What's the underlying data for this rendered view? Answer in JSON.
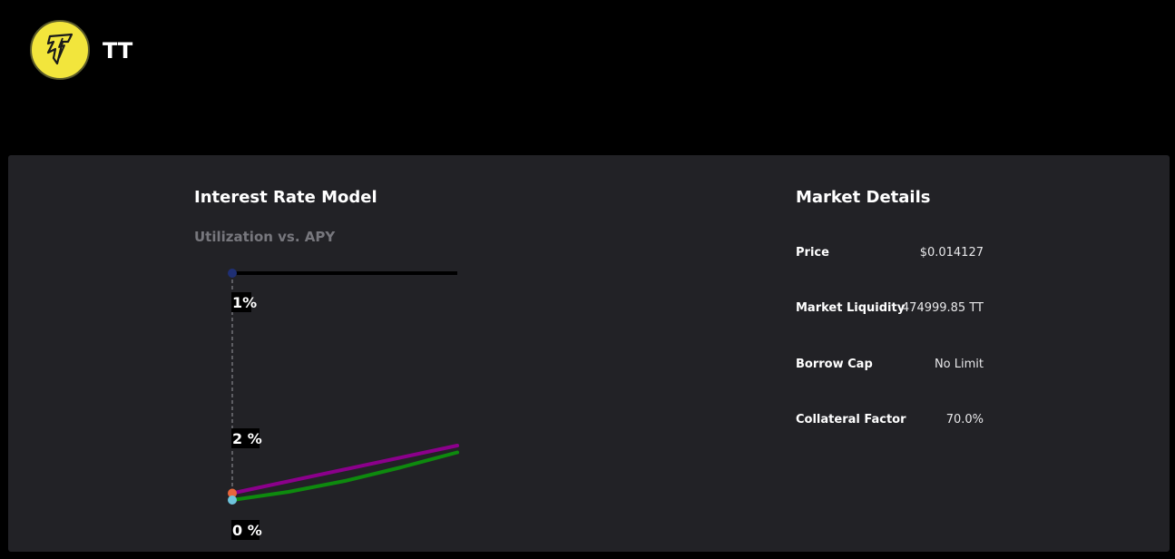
{
  "header": {
    "token_symbol": "TT",
    "logo_icon": "tt-bolt-logo-icon",
    "logo_color": "#f2e53c"
  },
  "interest_rate_model": {
    "title": "Interest Rate Model",
    "subtitle": "Utilization vs. APY",
    "label_top": "1%",
    "label_mid": "2 %",
    "label_bottom": "0 %",
    "chart_data": {
      "type": "line",
      "title": "",
      "xlabel": "",
      "ylabel": "",
      "series": [
        {
          "color": "#8b008b",
          "x": [
            0,
            100
          ],
          "y": [
            0.15,
            1.2
          ]
        },
        {
          "color": "#0e8a0e",
          "x": [
            0,
            25,
            50,
            75,
            100
          ],
          "y": [
            0.0,
            0.18,
            0.42,
            0.72,
            1.05
          ]
        }
      ],
      "markers": [
        {
          "color": "#1f2f73",
          "x": 0,
          "y": 5.0
        },
        {
          "color": "#e8663c",
          "x": 0,
          "y": 0.15
        },
        {
          "color": "#6ec4dc",
          "x": 0,
          "y": 0.0
        }
      ],
      "xlim": [
        0,
        100
      ],
      "ylim": [
        0,
        5.0
      ],
      "grid": false,
      "legend": "none"
    }
  },
  "market_details": {
    "title": "Market Details",
    "rows": [
      {
        "label": "Price",
        "value": "$0.014127"
      },
      {
        "label": "Market Liquidity",
        "value": "474999.85 TT"
      },
      {
        "label": "Borrow Cap",
        "value": "No Limit"
      },
      {
        "label": "Collateral Factor",
        "value": "70.0%"
      }
    ]
  }
}
